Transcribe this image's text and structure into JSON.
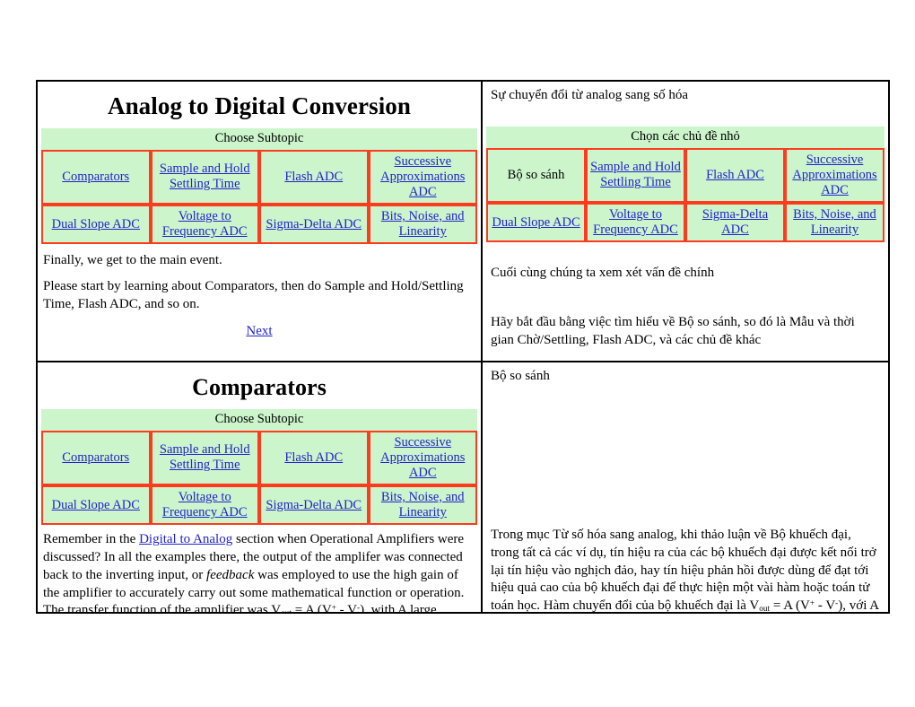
{
  "colors": {
    "link": "#2222cc",
    "cell_bg": "#ccf5cc",
    "cell_border": "#ff3b1e",
    "frame_border": "#000000"
  },
  "sections": [
    {
      "id": "analog-to-digital-conversion",
      "left": {
        "title": "Analog to Digital Conversion",
        "choose_label": "Choose Subtopic",
        "subtopics": [
          [
            {
              "label": "Comparators",
              "link": true
            },
            {
              "label": "Sample and Hold Settling Time",
              "link": true
            },
            {
              "label": "Flash ADC",
              "link": true
            },
            {
              "label": "Successive Approximations ADC",
              "link": true
            }
          ],
          [
            {
              "label": "Dual Slope ADC",
              "link": true
            },
            {
              "label": "Voltage to Frequency ADC",
              "link": true
            },
            {
              "label": "Sigma-Delta ADC",
              "link": true
            },
            {
              "label": "Bits, Noise, and Linearity",
              "link": true
            }
          ]
        ],
        "paragraphs": [
          "Finally, we get to the main event.",
          "Please start by learning about Comparators, then do Sample and Hold/Settling Time, Flash ADC, and so on."
        ],
        "next_label": "Next"
      },
      "right": {
        "title": "Sự chuyển đổi từ analog sang số hóa",
        "choose_label": "Chọn các chủ đề nhỏ",
        "subtopics": [
          [
            {
              "label": "Bộ so sánh",
              "link": false
            },
            {
              "label": "Sample and Hold Settling Time",
              "link": true
            },
            {
              "label": "Flash ADC",
              "link": true
            },
            {
              "label": "Successive Approximations ADC",
              "link": true
            }
          ],
          [
            {
              "label": "Dual Slope ADC",
              "link": true
            },
            {
              "label": "Voltage to Frequency ADC",
              "link": true
            },
            {
              "label": "Sigma-Delta ADC",
              "link": true
            },
            {
              "label": "Bits, Noise, and Linearity",
              "link": true
            }
          ]
        ],
        "paragraphs": [
          "Cuối cùng chúng ta xem xét vấn đề chính",
          "Hãy bắt đầu bằng việc tìm hiểu về Bộ so sánh, so đó là Mẫu và thời gian Chờ/Settling, Flash ADC, và các chủ đề khác"
        ]
      }
    },
    {
      "id": "comparators",
      "left": {
        "title": "Comparators",
        "choose_label": "Choose Subtopic",
        "subtopics": [
          [
            {
              "label": "Comparators",
              "link": true
            },
            {
              "label": "Sample and Hold Settling Time",
              "link": true
            },
            {
              "label": "Flash ADC",
              "link": true
            },
            {
              "label": "Successive Approximations ADC",
              "link": true
            }
          ],
          [
            {
              "label": "Dual Slope ADC",
              "link": true
            },
            {
              "label": "Voltage to Frequency ADC",
              "link": true
            },
            {
              "label": "Sigma-Delta ADC",
              "link": true
            },
            {
              "label": "Bits, Noise, and Linearity",
              "link": true
            }
          ]
        ],
        "body": {
          "before_link": "Remember in the ",
          "link_label": "Digital to Analog",
          "after_link": " section when Operational Amplifiers were discussed? In all the examples there, the output of the amplifer was connected back to the inverting input, or ",
          "italic_word": "feedback",
          "after_italic": " was employed to use the high gain of the amplifier to accurately carry out some mathematical function or operation. The transfer function of the amplifier was ",
          "formula_v": "V",
          "formula_sub": "out",
          "formula_eq": " = A (V",
          "formula_sup_plus": "+",
          "formula_minus": " - V",
          "formula_sup_minus": "-",
          "formula_close": "),",
          "tail": " with A large. Recall that the output of an operational amplifier can be no"
        }
      },
      "right": {
        "title": "Bộ so sánh",
        "body": {
          "lead": "Trong mục Từ số hóa sang analog, khi thảo luận về Bộ khuếch đại, trong tất cả các ví dụ, tín hiệu ra của các bộ khuếch đại được kết nối trở lại tín hiệu vào nghịch đảo, hay tín hiệu phản hồi được dùng để đạt tới hiệu quả cao của bộ khuếch đại để thực hiện một vài hàm hoặc toán tử toán học. Hàm chuyển đổi của bộ khuếch đại là ",
          "formula_v": "V",
          "formula_sub": "out",
          "formula_eq": " = A (V",
          "formula_sup_plus": "+",
          "formula_minus": " - V",
          "formula_sup_minus": "-",
          "formula_close": "),",
          "tail": " với A lớn. Nhắc lại rằng tín hiệu ra của bộ khuếch đại có thể không thấp hơn thế của phần âm của"
        }
      }
    }
  ]
}
